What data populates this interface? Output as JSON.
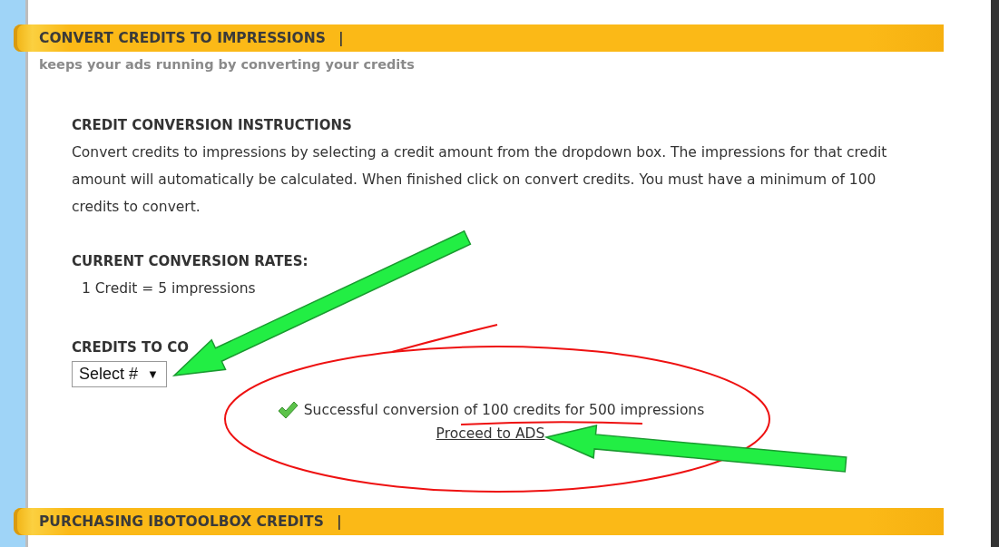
{
  "top_section": {
    "title": "CONVERT CREDITS TO IMPRESSIONS",
    "separator": "|",
    "subtitle": "keeps your ads running by converting your credits"
  },
  "instructions": {
    "heading": "CREDIT CONVERSION INSTRUCTIONS",
    "text": "Convert credits to impressions by selecting a credit amount from the dropdown box. The impressions for that credit amount will automatically be calculated. When finished click on convert credits. You must have a minimum of 100 credits to convert."
  },
  "rates": {
    "heading": "CURRENT CONVERSION RATES:",
    "lines": [
      "1 Credit = 5 impressions"
    ]
  },
  "convert": {
    "heading": "CREDITS TO CO",
    "select": {
      "value": "Select #",
      "caret": "▼"
    }
  },
  "result": {
    "message": "Successful conversion of 100 credits for 500 impressions",
    "link": "Proceed to ADS"
  },
  "bottom_section": {
    "title": "PURCHASING IBOTOOLBOX CREDITS",
    "separator": "|"
  }
}
